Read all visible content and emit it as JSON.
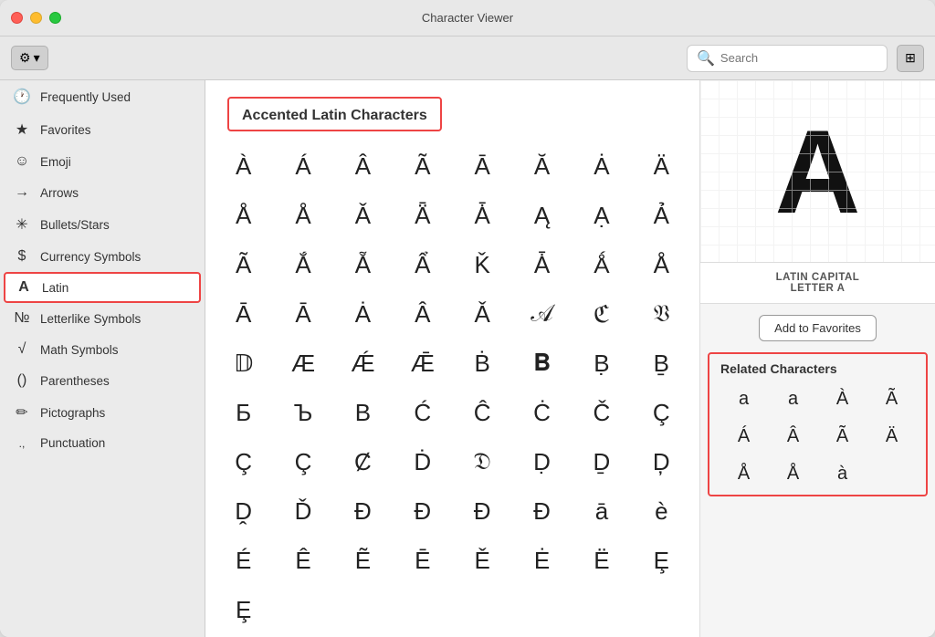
{
  "window": {
    "title": "Character Viewer"
  },
  "toolbar": {
    "gear_label": "⚙",
    "chevron_label": "▾",
    "search_placeholder": "Search",
    "grid_icon": "⊞"
  },
  "sidebar": {
    "items": [
      {
        "id": "frequently-used",
        "icon": "🕐",
        "label": "Frequently Used"
      },
      {
        "id": "favorites",
        "icon": "★",
        "label": "Favorites"
      },
      {
        "id": "emoji",
        "icon": "☺",
        "label": "Emoji"
      },
      {
        "id": "arrows",
        "icon": "→",
        "label": "Arrows"
      },
      {
        "id": "bullets-stars",
        "icon": "✳",
        "label": "Bullets/Stars"
      },
      {
        "id": "currency-symbols",
        "icon": "$",
        "label": "Currency Symbols"
      },
      {
        "id": "latin",
        "icon": "A",
        "label": "Latin",
        "active": true
      },
      {
        "id": "letterlike-symbols",
        "icon": "№",
        "label": "Letterlike Symbols"
      },
      {
        "id": "math-symbols",
        "icon": "√",
        "label": "Math Symbols"
      },
      {
        "id": "parentheses",
        "icon": "()",
        "label": "Parentheses"
      },
      {
        "id": "pictographs",
        "icon": "✏",
        "label": "Pictographs"
      },
      {
        "id": "punctuation",
        "icon": ".,",
        "label": "Punctuation"
      }
    ]
  },
  "main": {
    "section_title": "Accented Latin Characters",
    "characters": [
      "À",
      "Á",
      "Â",
      "Ã",
      "Ā",
      "Ă",
      "Ȧ",
      "Ä",
      "Å",
      "Å",
      "Ǎ",
      "Ǟ",
      "Ǡ",
      "Ą",
      "Ạ",
      "Ả",
      "Ã",
      "Ắ",
      "Ẵ",
      "Ẩ",
      "Ǩ",
      "Ǡ",
      "Ǻ",
      "Å",
      "Ā",
      "Ā",
      "Ȧ",
      "Â",
      "Ǎ",
      "𝒜",
      "ℭ",
      "𝔙",
      "𝔻",
      "Æ",
      "Ǽ",
      "Ǣ",
      "Ḃ",
      "𝐁",
      "Ḅ",
      "Ḇ",
      "Б",
      "Ъ",
      "В",
      "Ć",
      "Ĉ",
      "Ċ",
      "Č",
      "Ç",
      "Ç",
      "Ç",
      "Ȼ",
      "Ḋ",
      "𝔇",
      "Ḍ",
      "Ḏ",
      "Ḑ",
      "Ḓ",
      "Ď",
      "Đ",
      "Ɖ",
      "Ð",
      "Ð",
      "ā",
      "è",
      "É",
      "Ê",
      "Ẽ",
      "Ē",
      "Ě",
      "Ė",
      "Ë",
      "Ȩ",
      "Ȩ"
    ],
    "preview_char": "A",
    "preview_name": "LATIN CAPITAL\nLETTER A",
    "add_favorites_label": "Add to Favorites",
    "related_title": "Related Characters",
    "related_chars": [
      "a",
      "a",
      "À",
      "Ã",
      "Á",
      "Â",
      "Ã",
      "Ä",
      "Å",
      "Å",
      "à"
    ]
  }
}
